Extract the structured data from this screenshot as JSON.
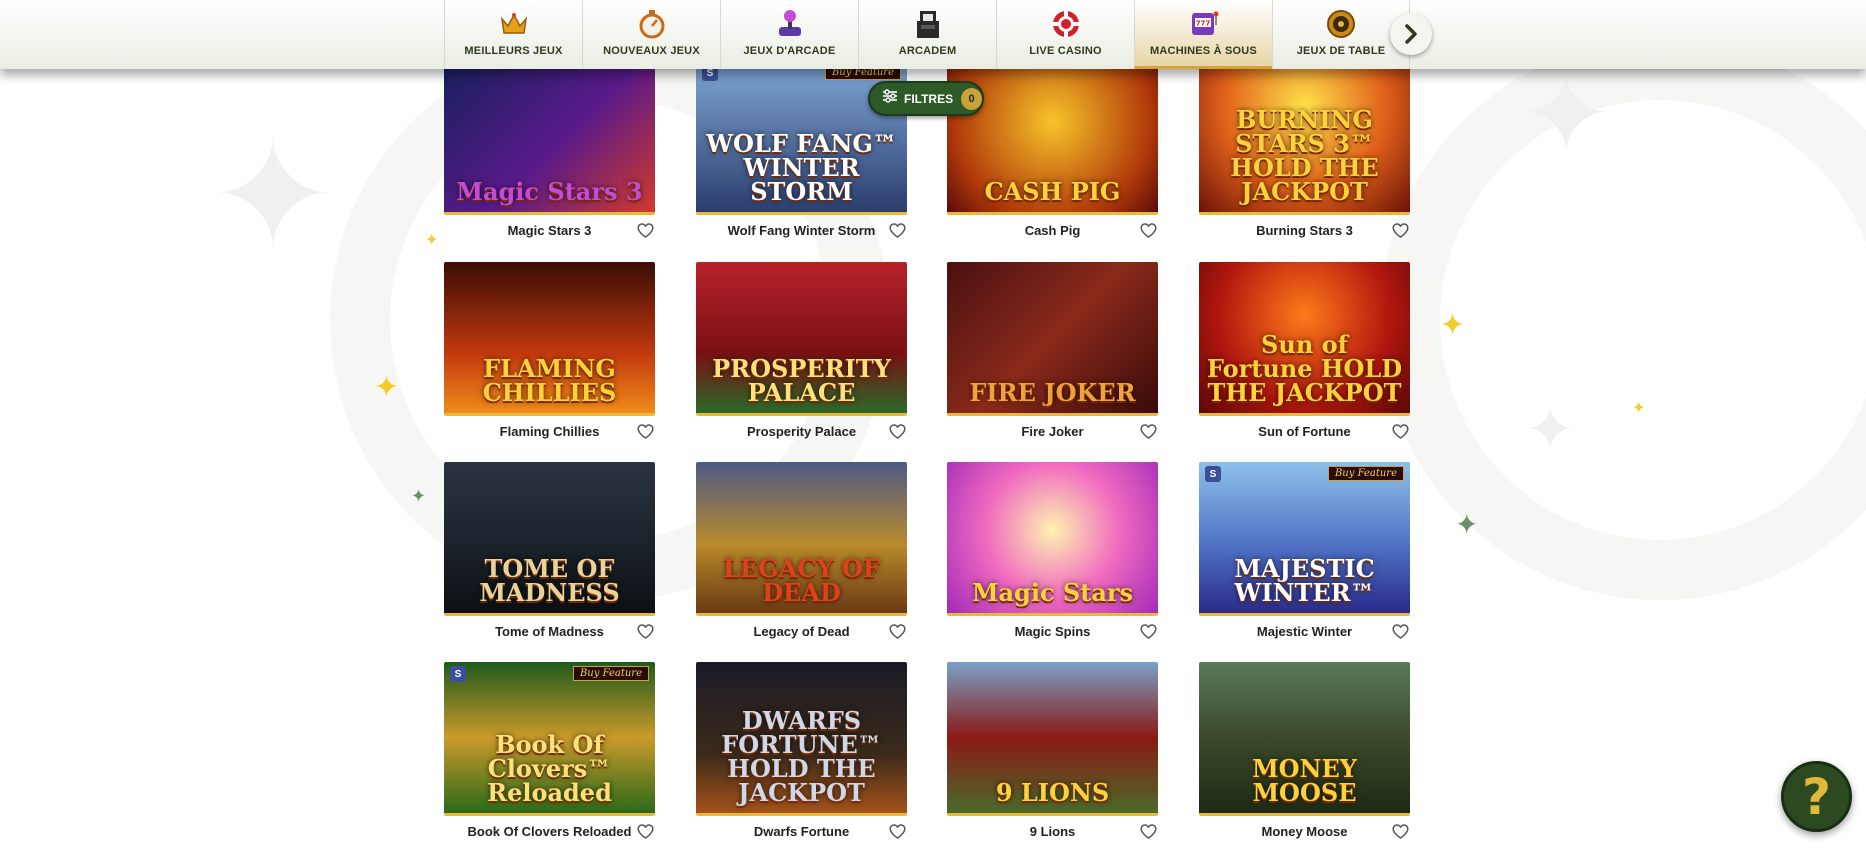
{
  "categories": [
    {
      "label": "MEILLEURS JEUX",
      "icon": "crown-icon",
      "active": false
    },
    {
      "label": "NOUVEAUX JEUX",
      "icon": "stopwatch-icon",
      "active": false
    },
    {
      "label": "JEUX D'ARCADE",
      "icon": "joystick-icon",
      "active": false
    },
    {
      "label": "ARCADEM",
      "icon": "arcade-machine-icon",
      "active": false
    },
    {
      "label": "LIVE CASINO",
      "icon": "casino-chip-icon",
      "active": false
    },
    {
      "label": "MACHINES À SOUS",
      "icon": "slot-machine-icon",
      "active": true
    },
    {
      "label": "JEUX DE TABLE",
      "icon": "roulette-icon",
      "active": false
    }
  ],
  "filter": {
    "label": "FILTRES",
    "count": "0",
    "icon": "sliders-icon"
  },
  "next_icon": "chevron-right-icon",
  "help": {
    "label": "?",
    "icon": "question-icon"
  },
  "colors": {
    "accent_gold": "#e9b93a",
    "brand_green": "#2e5a2a"
  },
  "games": [
    {
      "name": "Magic Stars 3",
      "art": "Magic Stars 3",
      "art_color": "#c44bd6",
      "bg": "linear-gradient(135deg,#17205e,#5a1a8a 55%,#d23a2a)",
      "buy_feature": false,
      "provider": false
    },
    {
      "name": "Wolf Fang Winter Storm",
      "art": "WOLF FANG™ WINTER STORM",
      "art_color": "#ffffff",
      "bg": "linear-gradient(#7ea7d6,#2c3e6e)",
      "buy_feature": true,
      "provider": true
    },
    {
      "name": "Cash Pig",
      "art": "CASH PIG",
      "art_color": "#ffd13b",
      "bg": "radial-gradient(circle at 50% 40%,#f7c52a,#b13a0a 70%,#5a0a0a)",
      "buy_feature": false,
      "provider": false
    },
    {
      "name": "Burning Stars 3",
      "art": "BURNING STARS 3™ HOLD THE JACKPOT",
      "art_color": "#ffd13b",
      "bg": "radial-gradient(circle at 50% 30%,#ffe14a,#e0601a 55%,#6a1208)",
      "buy_feature": false,
      "provider": false
    },
    {
      "name": "Flaming Chillies",
      "art": "FLAMING CHILLIES",
      "art_color": "#ffd13b",
      "bg": "linear-gradient(#3a0d06,#c2380e 60%,#f08a1a)",
      "buy_feature": false,
      "provider": false
    },
    {
      "name": "Prosperity Palace",
      "art": "PROSPERITY PALACE",
      "art_color": "#ffe07a",
      "bg": "linear-gradient(#b8222a,#7a1012 60%,#2b6a2a)",
      "buy_feature": false,
      "provider": false
    },
    {
      "name": "Fire Joker",
      "art": "FIRE JOKER",
      "art_color": "#f0a23a",
      "bg": "linear-gradient(135deg,#4a1010,#8a2a1a 50%,#3a0a0a)",
      "buy_feature": false,
      "provider": false
    },
    {
      "name": "Sun of Fortune",
      "art": "Sun of Fortune HOLD THE JACKPOT",
      "art_color": "#ffd13b",
      "bg": "radial-gradient(circle at 50% 35%,#ff7a1a,#b0160e 60%,#5a0808)",
      "buy_feature": false,
      "provider": false
    },
    {
      "name": "Tome of Madness",
      "art": "TOME OF MADNESS",
      "art_color": "#e8d39a",
      "bg": "linear-gradient(#2a3440,#1a2028 60%,#0c1014)",
      "buy_feature": false,
      "provider": false
    },
    {
      "name": "Legacy of Dead",
      "art": "LEGACY OF DEAD",
      "art_color": "#e0401a",
      "bg": "linear-gradient(#4e5a86,#b88a2a 55%,#6a3a14)",
      "buy_feature": false,
      "provider": false
    },
    {
      "name": "Magic Spins",
      "art": "Magic Stars",
      "art_color": "#ffd13b",
      "bg": "radial-gradient(circle at 50% 45%,#fff2b0,#f06ac0 50%,#a22ab8)",
      "buy_feature": false,
      "provider": false
    },
    {
      "name": "Majestic Winter",
      "art": "MAJESTIC WINTER™",
      "art_color": "#ffffff",
      "bg": "linear-gradient(#8fc0ea,#4a6ac0 60%,#2a2a8a)",
      "buy_feature": true,
      "provider": true
    },
    {
      "name": "Book Of Clovers Reloaded",
      "art": "Book Of Clovers™ Reloaded",
      "art_color": "#ffe07a",
      "bg": "linear-gradient(#1f5a1c,#c99a2a 50%,#2a6a1a)",
      "buy_feature": true,
      "provider": true
    },
    {
      "name": "Dwarfs Fortune",
      "art": "DWARFS FORTUNE™ HOLD THE JACKPOT",
      "art_color": "#cfd8e8",
      "bg": "linear-gradient(#1a1a26,#3a2a1a 60%,#a4521a)",
      "buy_feature": false,
      "provider": false
    },
    {
      "name": "9 Lions",
      "art": "9 LIONS",
      "art_color": "#ffd13b",
      "bg": "linear-gradient(#7aa0c8,#8a1a14 50%,#4a6a2a)",
      "buy_feature": false,
      "provider": false
    },
    {
      "name": "Money Moose",
      "art": "MONEY MOOSE",
      "art_color": "#ffd13b",
      "bg": "linear-gradient(#5a7a5a,#3a4a2a 50%,#1e2a14)",
      "buy_feature": false,
      "provider": false
    }
  ],
  "buy_feature_label": "Buy Feature",
  "provider_label": "S",
  "favorite_icon": "heart-outline-icon"
}
